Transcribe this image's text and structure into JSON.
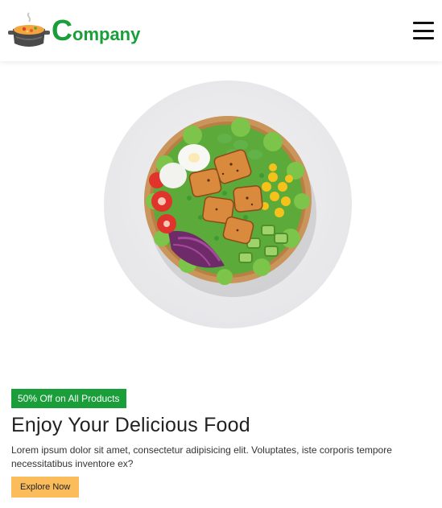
{
  "header": {
    "logo_first_letter": "C",
    "logo_rest": "ompany",
    "logo_icon": "cooking-pot-icon",
    "menu_icon": "hamburger-menu-icon"
  },
  "hero": {
    "image": "salad-bowl-image",
    "badge": "50% Off on All Products",
    "title": "Enjoy Your Delicious Food",
    "description": "Lorem ipsum dolor sit amet, consectetur adipisicing elit. Voluptates, iste corporis tempore necessitatibus inventore ex?",
    "cta_label": "Explore Now"
  },
  "colors": {
    "brand_green": "#1a9e3a",
    "cta_yellow": "#fbbd5c",
    "header_bg": "#ffffff"
  }
}
